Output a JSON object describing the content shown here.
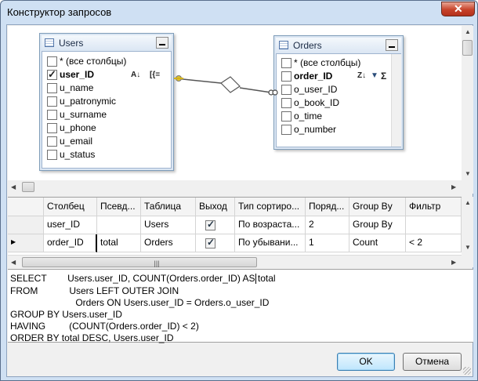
{
  "window": {
    "title": "Конструктор запросов",
    "close_glyph": "✕"
  },
  "diagram": {
    "tables": [
      {
        "name": "Users",
        "fields": [
          {
            "label": "* (все столбцы)",
            "checked": false,
            "bold": false
          },
          {
            "label": "user_ID",
            "checked": true,
            "bold": true
          },
          {
            "label": "u_name",
            "checked": false,
            "bold": false
          },
          {
            "label": "u_patronymic",
            "checked": false,
            "bold": false
          },
          {
            "label": "u_surname",
            "checked": false,
            "bold": false
          },
          {
            "label": "u_phone",
            "checked": false,
            "bold": false
          },
          {
            "label": "u_email",
            "checked": false,
            "bold": false
          },
          {
            "label": "u_status",
            "checked": false,
            "bold": false
          }
        ],
        "sort_icon_text": "A↓",
        "group_icon_text": "[{="
      },
      {
        "name": "Orders",
        "fields": [
          {
            "label": "* (все столбцы)",
            "checked": false,
            "bold": false
          },
          {
            "label": "order_ID",
            "checked": false,
            "bold": true
          },
          {
            "label": "o_user_ID",
            "checked": false,
            "bold": false
          },
          {
            "label": "o_book_ID",
            "checked": false,
            "bold": false
          },
          {
            "label": "o_time",
            "checked": false,
            "bold": false
          },
          {
            "label": "o_number",
            "checked": false,
            "bold": false
          }
        ],
        "sort_icon_text": "Z↓",
        "filter_icon_text": "▼",
        "sum_icon_text": "Σ"
      }
    ]
  },
  "grid": {
    "columns": [
      "Столбец",
      "Псевд...",
      "Таблица",
      "Выход",
      "Тип сортиро...",
      "Поряд...",
      "Group By",
      "Фильтр"
    ],
    "rows": [
      {
        "marker": "",
        "column": "user_ID",
        "alias": "",
        "table": "Users",
        "output": true,
        "sort_type": "По возраста...",
        "order": "2",
        "group_by": "Group By",
        "filter": ""
      },
      {
        "marker": "▶",
        "column": "order_ID",
        "alias": "total",
        "table": "Orders",
        "output": true,
        "sort_type": "По убывани...",
        "order": "1",
        "group_by": "Count",
        "filter": "< 2"
      }
    ]
  },
  "sql": {
    "lines": [
      "SELECT        Users.user_ID, COUNT(Orders.order_ID) AS total",
      "FROM            Users LEFT OUTER JOIN",
      "                         Orders ON Users.user_ID = Orders.o_user_ID",
      "GROUP BY Users.user_ID",
      "HAVING         (COUNT(Orders.order_ID) < 2)",
      "ORDER BY total DESC, Users.user_ID"
    ]
  },
  "buttons": {
    "ok": "OK",
    "cancel": "Отмена"
  },
  "colors": {
    "title_bg": "#cfe0f3",
    "close_red": "#c7432a",
    "table_header": "#dce7f4",
    "default_button": "#bee6fd"
  }
}
